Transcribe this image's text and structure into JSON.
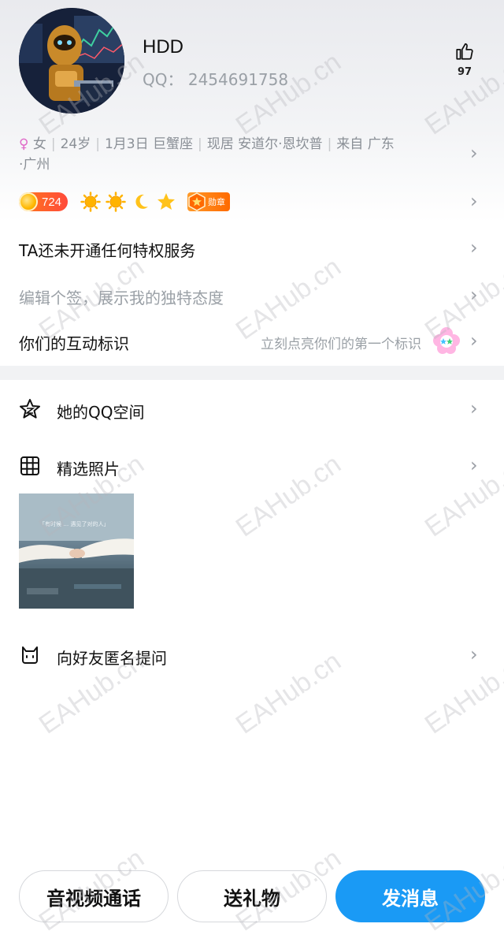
{
  "profile": {
    "name": "HDD",
    "qq": "QQ： 2454691758",
    "likes": "97"
  },
  "info": {
    "gender_symbol": "♀",
    "gender": "女",
    "age": "24岁",
    "birthday": "1月3日 巨蟹座",
    "location": "现居 安道尔·恩坎普",
    "hometown_1": "来自 广东",
    "hometown_2": "·广州"
  },
  "level": {
    "value": "724",
    "medal_label": "勋章"
  },
  "privilege_text": "TA还未开通任何特权服务",
  "signature_placeholder": "编辑个签，展示我的独特态度",
  "interaction": {
    "label": "你们的互动标识",
    "hint": "立刻点亮你们的第一个标识"
  },
  "menu": {
    "qzone": "她的QQ空间",
    "photos": "精选照片",
    "anon_question": "向好友匿名提问"
  },
  "photo_caption": "「有时候 … 遇见了对的人」",
  "buttons": {
    "call": "音视频通话",
    "gift": "送礼物",
    "message": "发消息"
  },
  "chevron": "›",
  "watermark": "EAHub.cn",
  "colors": {
    "accent": "#1a9af5",
    "female": "#e06ac8",
    "level_badge": "#ff5a2a"
  }
}
